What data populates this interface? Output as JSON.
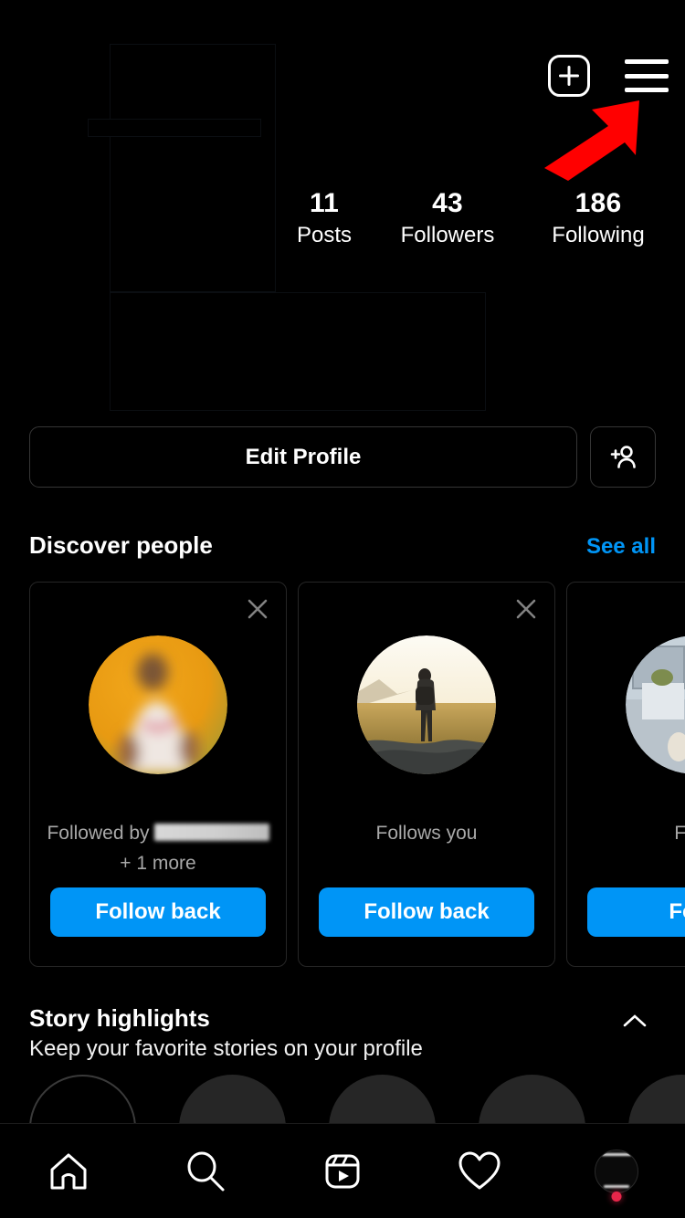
{
  "theme": {
    "bg": "#000000",
    "accent_blue": "#0095F6",
    "arrow_red": "#FF0000",
    "muted_text": "#A8A8A8",
    "card_border": "#262626"
  },
  "header": {
    "create_icon": "plus-square-icon",
    "menu_icon": "hamburger-menu-icon",
    "annotation": {
      "type": "arrow-annotation",
      "color": "#FF0000",
      "points_to": "hamburger-menu-icon",
      "direction": "up-right"
    },
    "profile_area_redacted": true
  },
  "stats": [
    {
      "value": "11",
      "label": "Posts"
    },
    {
      "value": "43",
      "label": "Followers"
    },
    {
      "value": "186",
      "label": "Following"
    }
  ],
  "actions": {
    "edit_profile_label": "Edit Profile",
    "add_person_icon": "add-person-icon"
  },
  "discover": {
    "title": "Discover people",
    "see_all_label": "See all",
    "cards": [
      {
        "subtitle_prefix": "Followed by",
        "subtitle_redacted": true,
        "subtitle_extra": "+ 1 more",
        "button_label": "Follow back",
        "close_icon": "close-icon",
        "avatar": "blurred-orange-portrait"
      },
      {
        "subtitle_prefix": "Follows you",
        "subtitle_redacted": false,
        "subtitle_extra": "",
        "button_label": "Follow back",
        "close_icon": "close-icon",
        "avatar": "person-in-wheat-field"
      },
      {
        "subtitle_prefix": "Follo",
        "subtitle_redacted": false,
        "subtitle_extra": "",
        "button_label": "Follo",
        "close_icon": "close-icon",
        "avatar": "person-with-glasses-cafe"
      }
    ]
  },
  "story_highlights": {
    "title": "Story highlights",
    "subtitle": "Keep your favorite stories on your profile",
    "collapse_icon": "chevron-up-icon",
    "circle_count": 5
  },
  "bottom_nav": [
    {
      "name": "home",
      "icon": "home-icon"
    },
    {
      "name": "search",
      "icon": "search-icon"
    },
    {
      "name": "reels",
      "icon": "reels-icon"
    },
    {
      "name": "activity",
      "icon": "heart-icon"
    },
    {
      "name": "profile",
      "icon": "profile-avatar-icon",
      "badge": true
    }
  ]
}
